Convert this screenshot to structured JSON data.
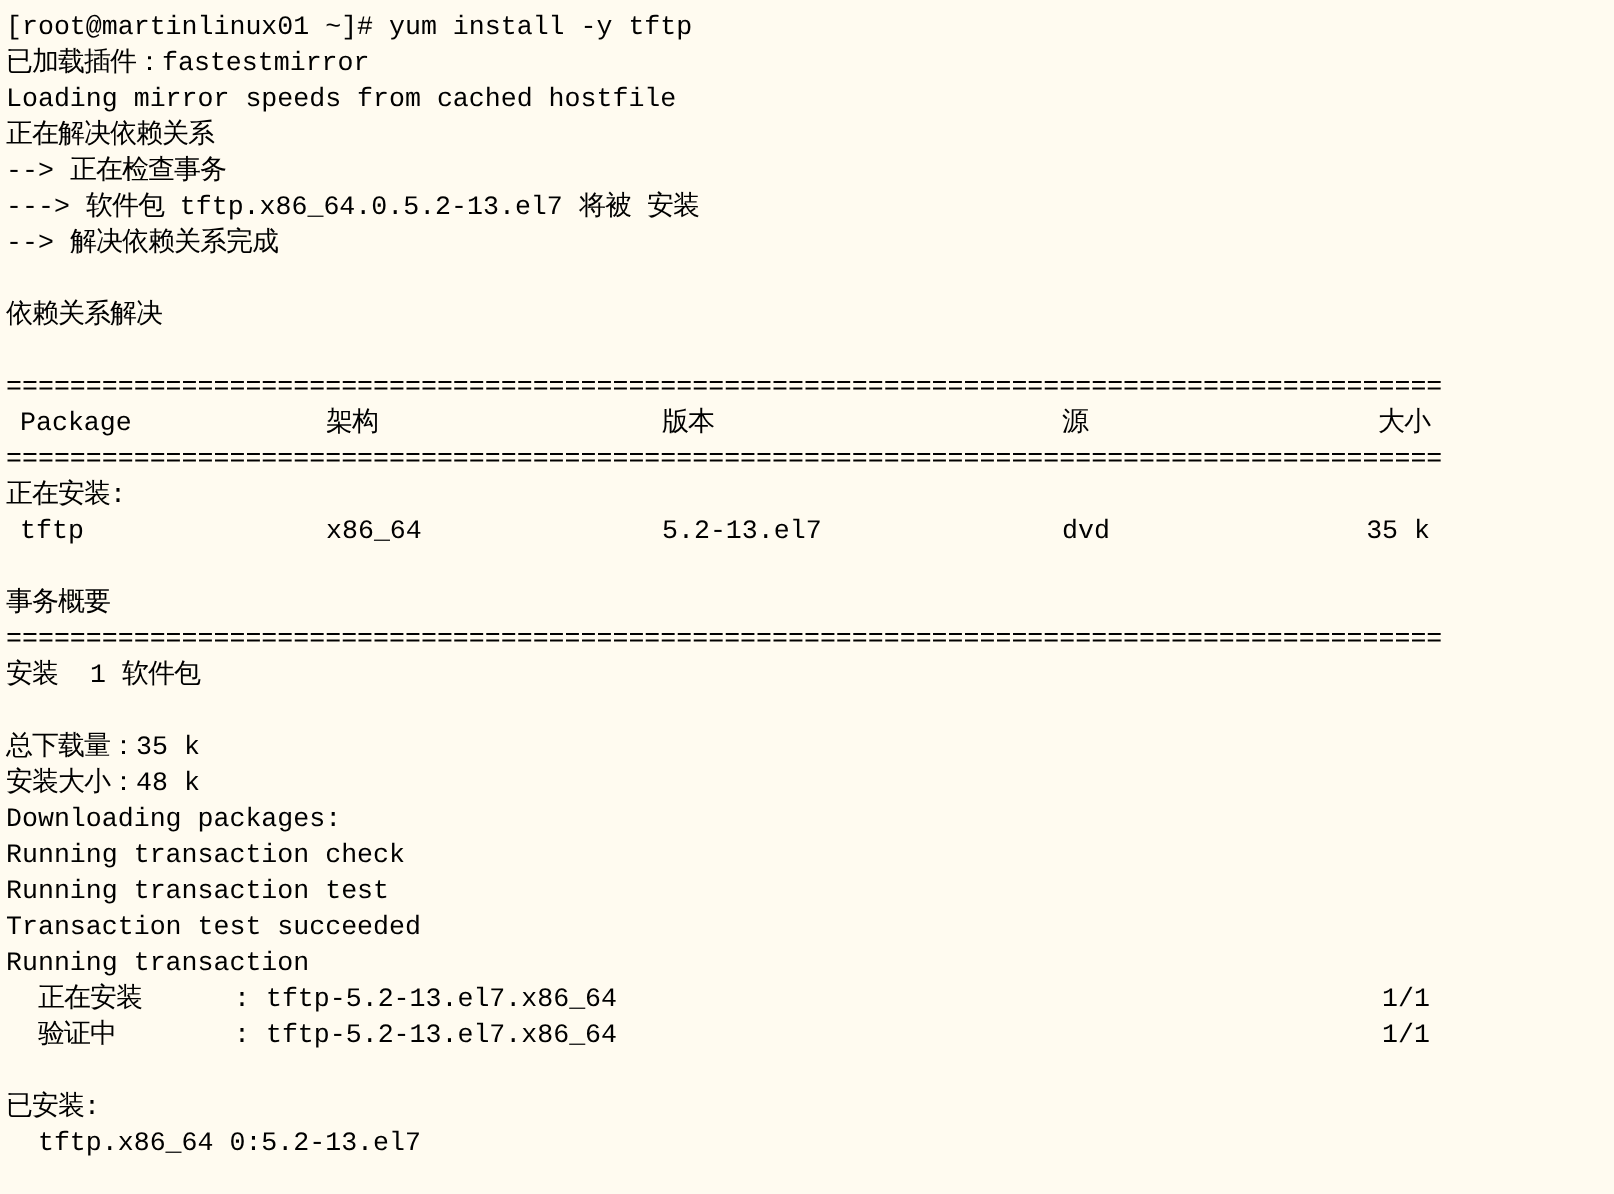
{
  "terminal": {
    "lines": [
      {
        "kind": "text",
        "text": "[root@martinlinux01 ~]# yum install -y tftp"
      },
      {
        "kind": "text",
        "text": "已加载插件：fastestmirror"
      },
      {
        "kind": "text",
        "text": "Loading mirror speeds from cached hostfile"
      },
      {
        "kind": "text",
        "text": "正在解决依赖关系"
      },
      {
        "kind": "text",
        "text": "--> 正在检查事务"
      },
      {
        "kind": "text",
        "text": "---> 软件包 tftp.x86_64.0.5.2-13.el7 将被 安装"
      },
      {
        "kind": "text",
        "text": "--> 解决依赖关系完成"
      },
      {
        "kind": "blank"
      },
      {
        "kind": "text",
        "text": "依赖关系解决"
      },
      {
        "kind": "blank"
      },
      {
        "kind": "rule",
        "text": "=========================================================================================="
      },
      {
        "kind": "header",
        "cells": [
          "Package",
          "架构",
          "版本",
          "源",
          "大小"
        ]
      },
      {
        "kind": "rule",
        "text": "=========================================================================================="
      },
      {
        "kind": "text",
        "text": "正在安装:"
      },
      {
        "kind": "row",
        "cells": [
          "tftp",
          "x86_64",
          "5.2-13.el7",
          "dvd",
          "35 k"
        ]
      },
      {
        "kind": "blank"
      },
      {
        "kind": "text",
        "text": "事务概要"
      },
      {
        "kind": "rule",
        "text": "=========================================================================================="
      },
      {
        "kind": "text",
        "text": "安装  1 软件包"
      },
      {
        "kind": "blank"
      },
      {
        "kind": "text",
        "text": "总下载量：35 k"
      },
      {
        "kind": "text",
        "text": "安装大小：48 k"
      },
      {
        "kind": "text",
        "text": "Downloading packages:"
      },
      {
        "kind": "text",
        "text": "Running transaction check"
      },
      {
        "kind": "text",
        "text": "Running transaction test"
      },
      {
        "kind": "text",
        "text": "Transaction test succeeded"
      },
      {
        "kind": "text",
        "text": "Running transaction"
      },
      {
        "kind": "step",
        "cells": [
          "正在安装",
          ": tftp-5.2-13.el7.x86_64",
          "1/1"
        ]
      },
      {
        "kind": "step",
        "cells": [
          "验证中",
          ": tftp-5.2-13.el7.x86_64",
          "1/1"
        ]
      },
      {
        "kind": "blank"
      },
      {
        "kind": "text",
        "text": "已安装:"
      },
      {
        "kind": "text",
        "text": "  tftp.x86_64 0:5.2-13.el7"
      }
    ]
  }
}
